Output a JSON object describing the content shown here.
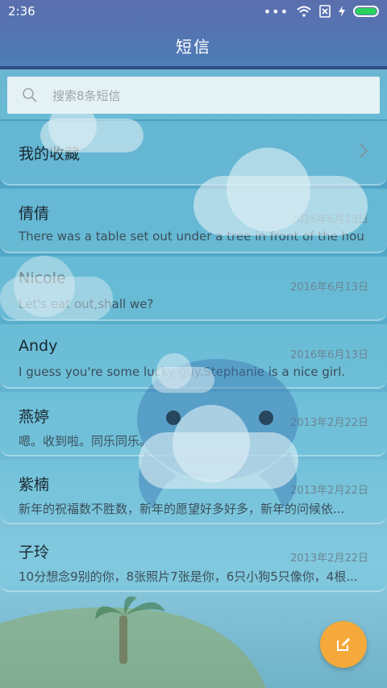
{
  "status_bar": {
    "time": "2:36"
  },
  "header": {
    "title": "短信"
  },
  "search": {
    "placeholder": "搜索8条短信"
  },
  "favorites": {
    "label": "我的收藏"
  },
  "conversations": [
    {
      "name": "倩倩",
      "date": "2016年6月13日",
      "preview": "There was a table set out under a tree in front of the hous"
    },
    {
      "name": "Nicole",
      "date": "2016年6月13日",
      "preview": "Let's eat out,shall we?"
    },
    {
      "name": "Andy",
      "date": "2016年6月13日",
      "preview": "I guess you're some lucky guy.Stephanie is a nice girl."
    },
    {
      "name": "燕婷",
      "date": "2013年2月22日",
      "preview": "嗯。收到啦。同乐同乐。"
    },
    {
      "name": "紫楠",
      "date": "2013年2月22日",
      "preview": "新年的祝福数不胜数，新年的愿望好多好多，新年的问候依..."
    },
    {
      "name": "子玲",
      "date": "2013年2月22日",
      "preview": "10分想念9别的你，8张照片7张是你，6只小狗5只像你，4根..."
    }
  ],
  "colors": {
    "accent_fab": "#f5a93a",
    "battery": "#29d35e"
  }
}
